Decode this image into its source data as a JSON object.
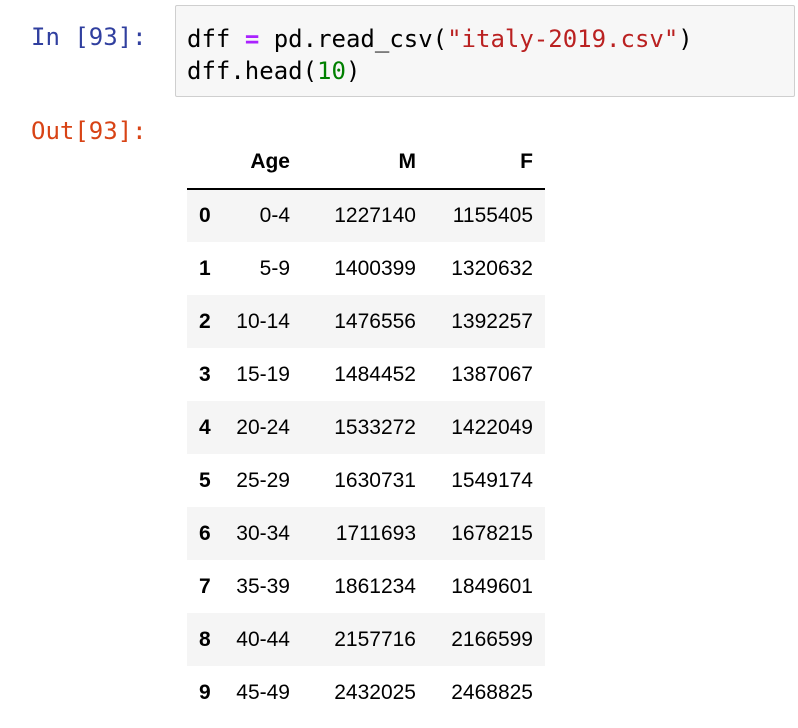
{
  "input_cell": {
    "prompt": "In [93]:",
    "line1": {
      "var": "dff",
      "op": "=",
      "call_prefix": "pd.read_csv(",
      "string": "\"italy-2019.csv\"",
      "call_suffix": ")"
    },
    "line2": {
      "call_prefix": "dff.head(",
      "number": "10",
      "call_suffix": ")"
    }
  },
  "output_cell": {
    "prompt": "Out[93]:"
  },
  "dataframe": {
    "columns": [
      "",
      "Age",
      "M",
      "F"
    ],
    "rows": [
      {
        "index": "0",
        "age": "0-4",
        "m": "1227140",
        "f": "1155405"
      },
      {
        "index": "1",
        "age": "5-9",
        "m": "1400399",
        "f": "1320632"
      },
      {
        "index": "2",
        "age": "10-14",
        "m": "1476556",
        "f": "1392257"
      },
      {
        "index": "3",
        "age": "15-19",
        "m": "1484452",
        "f": "1387067"
      },
      {
        "index": "4",
        "age": "20-24",
        "m": "1533272",
        "f": "1422049"
      },
      {
        "index": "5",
        "age": "25-29",
        "m": "1630731",
        "f": "1549174"
      },
      {
        "index": "6",
        "age": "30-34",
        "m": "1711693",
        "f": "1678215"
      },
      {
        "index": "7",
        "age": "35-39",
        "m": "1861234",
        "f": "1849601"
      },
      {
        "index": "8",
        "age": "40-44",
        "m": "2157716",
        "f": "2166599"
      },
      {
        "index": "9",
        "age": "45-49",
        "m": "2432025",
        "f": "2468825"
      }
    ]
  },
  "colors": {
    "in_prompt": "#303f9f",
    "out_prompt": "#d84315",
    "operator": "#aa22ff",
    "string": "#ba2121",
    "number": "#008000",
    "cell_bg": "#f7f7f7",
    "row_stripe": "#f5f5f5"
  }
}
